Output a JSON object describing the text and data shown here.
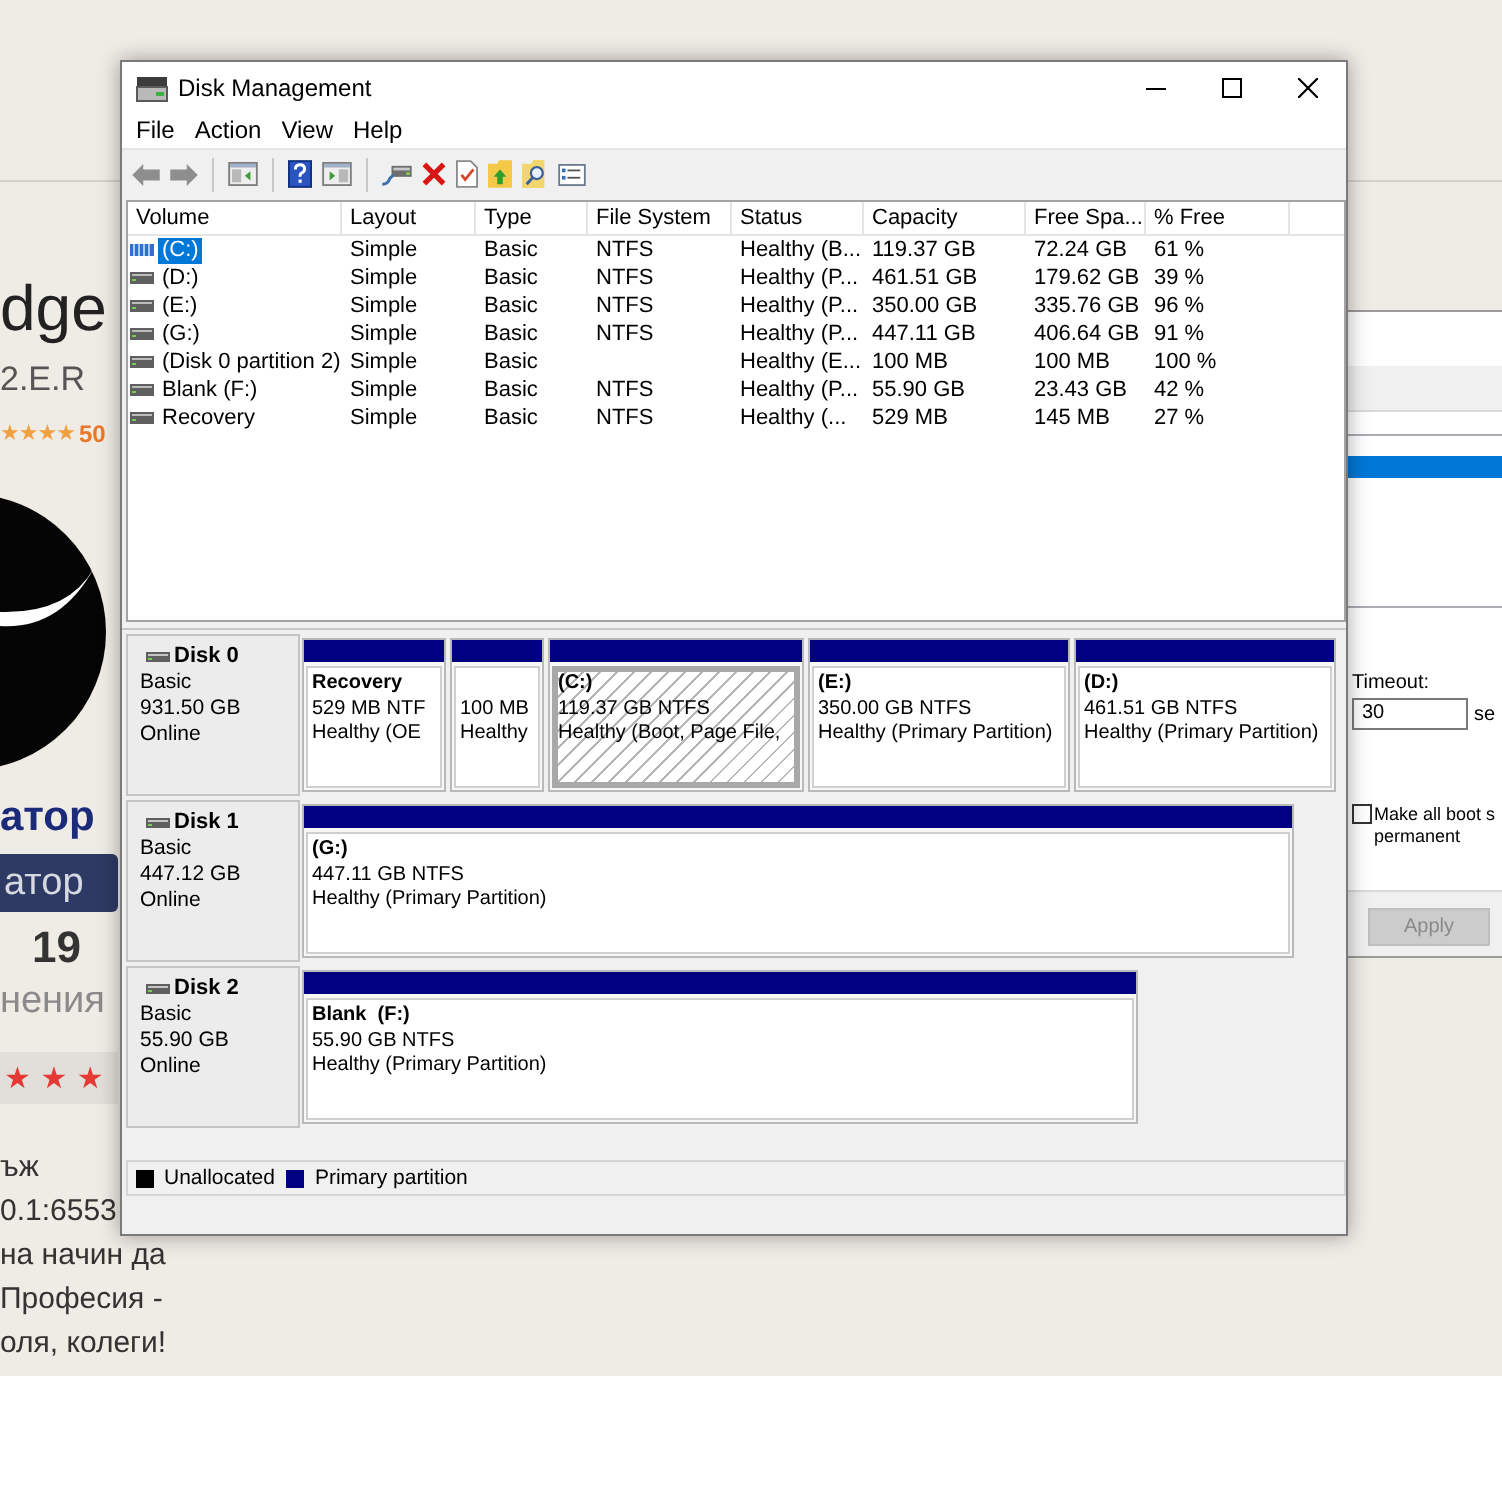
{
  "background_page": {
    "heading": "dge",
    "subtitle": "2.E.R",
    "rating_stars": "★★★★",
    "rating_count": "50",
    "role_link": "атор",
    "role_button": "атор",
    "post_count": "19",
    "post_count_label": "нения",
    "reputation_stars": "★ ★ ★",
    "post_lines": [
      "ъж",
      "0.1:6553",
      "на начин да",
      "Професия -",
      "оля, колеги!"
    ]
  },
  "boot_dialog": {
    "entries": [
      {
        "selected": true
      }
    ],
    "timeout_label": "Timeout:",
    "timeout_value": "30",
    "timeout_unit": "se",
    "checkbox": {
      "label_lines": [
        "Make all boot s",
        "permanent"
      ],
      "checked": false
    },
    "buttons": [
      {
        "label": "Apply",
        "disabled": true
      }
    ]
  },
  "window": {
    "title": "Disk Management"
  },
  "menu": [
    "File",
    "Action",
    "View",
    "Help"
  ],
  "volume_table": {
    "columns": [
      "Volume",
      "Layout",
      "Type",
      "File System",
      "Status",
      "Capacity",
      "Free Spa...",
      "% Free"
    ],
    "rows": [
      {
        "volume": "(C:)",
        "layout": "Simple",
        "type": "Basic",
        "file_system": "NTFS",
        "status": "Healthy (B...",
        "capacity": "119.37 GB",
        "free_space": "72.24 GB",
        "percent_free": "61 %",
        "selected": true
      },
      {
        "volume": "(D:)",
        "layout": "Simple",
        "type": "Basic",
        "file_system": "NTFS",
        "status": "Healthy (P...",
        "capacity": "461.51 GB",
        "free_space": "179.62 GB",
        "percent_free": "39 %",
        "selected": false
      },
      {
        "volume": "(E:)",
        "layout": "Simple",
        "type": "Basic",
        "file_system": "NTFS",
        "status": "Healthy (P...",
        "capacity": "350.00 GB",
        "free_space": "335.76 GB",
        "percent_free": "96 %",
        "selected": false
      },
      {
        "volume": "(G:)",
        "layout": "Simple",
        "type": "Basic",
        "file_system": "NTFS",
        "status": "Healthy (P...",
        "capacity": "447.11 GB",
        "free_space": "406.64 GB",
        "percent_free": "91 %",
        "selected": false
      },
      {
        "volume": "(Disk 0 partition 2)",
        "layout": "Simple",
        "type": "Basic",
        "status": "Healthy (E...",
        "capacity": "100 MB",
        "free_space": "100 MB",
        "percent_free": "100 %",
        "selected": false
      },
      {
        "volume": "Blank (F:)",
        "layout": "Simple",
        "type": "Basic",
        "file_system": "NTFS",
        "status": "Healthy (P...",
        "capacity": "55.90 GB",
        "free_space": "23.43 GB",
        "percent_free": "42 %",
        "selected": false
      },
      {
        "volume": "Recovery",
        "layout": "Simple",
        "type": "Basic",
        "file_system": "NTFS",
        "status": "Healthy (...",
        "capacity": "529 MB",
        "free_space": "145 MB",
        "percent_free": "27 %",
        "selected": false
      }
    ]
  },
  "disks": [
    {
      "name": "Disk 0",
      "type": "Basic",
      "size": "931.50 GB",
      "state": "Online",
      "partitions": [
        {
          "name": "Recovery",
          "size": "529 MB NTF",
          "status": "Healthy (OE",
          "selected": false
        },
        {
          "size": "100 MB",
          "status": "Healthy",
          "selected": false
        },
        {
          "name": "(C:)",
          "size": "119.37 GB NTFS",
          "status": "Healthy (Boot, Page File,",
          "selected": true
        },
        {
          "name": "(E:)",
          "size": "350.00 GB NTFS",
          "status": "Healthy (Primary Partition)",
          "selected": false
        },
        {
          "name": "(D:)",
          "size": "461.51 GB NTFS",
          "status": "Healthy (Primary Partition)",
          "selected": false
        }
      ]
    },
    {
      "name": "Disk 1",
      "type": "Basic",
      "size": "447.12 GB",
      "state": "Online",
      "partitions": [
        {
          "name": "(G:)",
          "size": "447.11 GB NTFS",
          "status": "Healthy (Primary Partition)",
          "selected": false
        }
      ]
    },
    {
      "name": "Disk 2",
      "type": "Basic",
      "size": "55.90 GB",
      "state": "Online",
      "partitions": [
        {
          "name": "Blank  (F:)",
          "size": "55.90 GB NTFS",
          "status": "Healthy (Primary Partition)",
          "selected": false
        }
      ]
    }
  ],
  "legend": [
    {
      "label": "Unallocated",
      "color": "#000000"
    },
    {
      "label": "Primary partition",
      "color": "#000080"
    }
  ]
}
